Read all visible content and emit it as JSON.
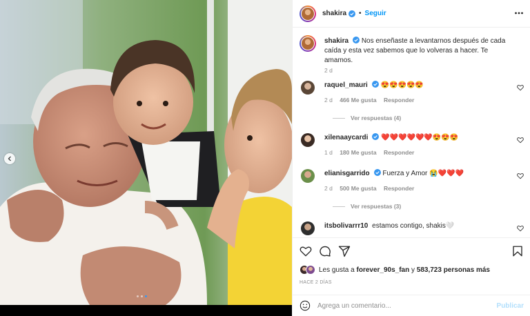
{
  "post": {
    "author": "shakira",
    "follow_label": "Seguir",
    "separator": "•",
    "more_icon": "more-horizontal-icon",
    "verified_color": "#3897f0"
  },
  "caption": {
    "username": "shakira",
    "text": "Nos enseñaste a levantarnos después de cada caída y esta vez sabemos que lo volveras a hacer. Te amamos.",
    "time": "2 d"
  },
  "comments": [
    {
      "username": "raquel_mauri",
      "verified": true,
      "text": "😍😍😍😍😍",
      "time": "2 d",
      "likes": "466 Me gusta",
      "reply_label": "Responder",
      "view_replies": "Ver respuestas (4)"
    },
    {
      "username": "xilenaaycardi",
      "verified": true,
      "text": "❤️❤️❤️❤️❤️❤️😍😍😍",
      "time": "1 d",
      "likes": "180 Me gusta",
      "reply_label": "Responder"
    },
    {
      "username": "elianisgarrido",
      "verified": true,
      "text": "Fuerza y Amor 😭❤️❤️❤️",
      "time": "2 d",
      "likes": "500 Me gusta",
      "reply_label": "Responder",
      "view_replies": "Ver respuestas (3)"
    },
    {
      "username": "itsbolivarrr10",
      "verified": false,
      "text": "estamos contigo, shakis🤍"
    }
  ],
  "actions": {
    "like_icon": "heart-icon",
    "comment_icon": "comment-icon",
    "share_icon": "send-icon",
    "save_icon": "bookmark-icon"
  },
  "likes": {
    "prefix": "Les gusta a",
    "user": "forever_90s_fan",
    "middle": "y",
    "count": "583,723 personas más"
  },
  "timestamp": "HACE 2 DÍAS",
  "add_comment": {
    "placeholder": "Agrega un comentario...",
    "publish_label": "Publicar",
    "emoji_icon": "emoji-icon"
  },
  "carousel": {
    "total": 3,
    "active_index": 2,
    "prev_icon": "chevron-left-icon"
  },
  "colors": {
    "link_blue": "#0095f6",
    "publish_disabled": "#b2dffc",
    "secondary_text": "#8e8e8e"
  }
}
